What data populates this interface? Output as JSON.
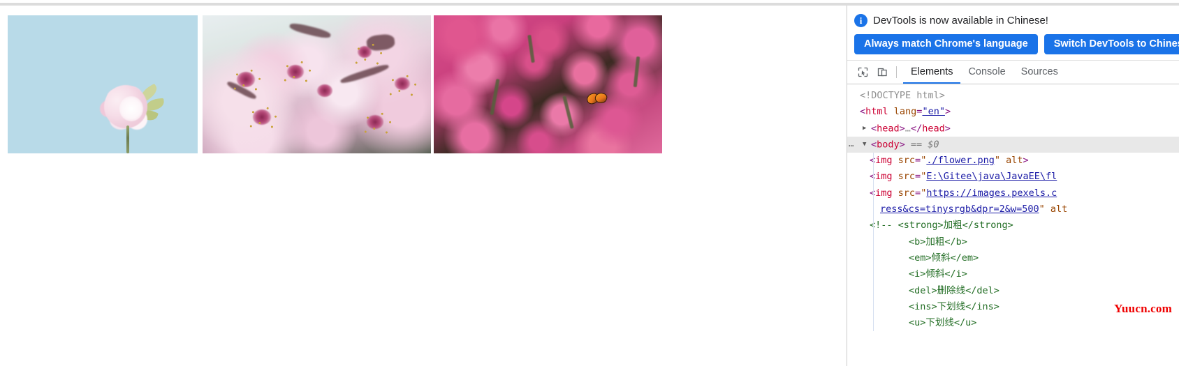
{
  "window": {
    "page_background": "#ffffff",
    "chrome_strip_color": "#dcdcdc"
  },
  "viewport": {
    "images": [
      {
        "name": "local-relative-flower",
        "alt": "",
        "description": "Pink cherry blossom on pale blue background",
        "dominant_color": "#b8dae8"
      },
      {
        "name": "absolute-path-flower",
        "alt": "",
        "description": "Close-up macro of pink cherry blossoms on branch",
        "dominant_color": "#e7cfdc"
      },
      {
        "name": "remote-pexels-flower",
        "alt": "",
        "description": "Dense cluster of pink phlox flowers with an orange butterfly",
        "dominant_color": "#d84f8b"
      }
    ]
  },
  "devtools": {
    "notice": {
      "icon": "info-icon",
      "icon_glyph": "i",
      "text": "DevTools is now available in Chinese!",
      "buttons": [
        {
          "label": "Always match Chrome's language",
          "color": "#1a73e8"
        },
        {
          "label": "Switch DevTools to Chinese",
          "color": "#1a73e8"
        }
      ]
    },
    "toolbar": {
      "inspect_icon": "inspect-element-icon",
      "device_icon": "device-toolbar-icon"
    },
    "tabs": [
      {
        "label": "Elements",
        "active": true
      },
      {
        "label": "Console",
        "active": false
      },
      {
        "label": "Sources",
        "active": false
      }
    ],
    "accent_color": "#1a73e8",
    "dom_tree": [
      {
        "id": "doctype",
        "indent": 0,
        "twisty": "",
        "selected": false,
        "parts": [
          {
            "t": "doctype",
            "s": "<!DOCTYPE html>"
          }
        ]
      },
      {
        "id": "html",
        "indent": 0,
        "twisty": "",
        "selected": false,
        "parts": [
          {
            "t": "punct",
            "s": "<"
          },
          {
            "t": "tagp",
            "s": "html"
          },
          {
            "t": "attr",
            "s": " lang"
          },
          {
            "t": "punct",
            "s": "="
          },
          {
            "t": "val-plain",
            "s": "\"en\""
          },
          {
            "t": "punct",
            "s": ">"
          }
        ]
      },
      {
        "id": "head",
        "indent": 1,
        "twisty": "collapsed",
        "selected": false,
        "parts": [
          {
            "t": "punct",
            "s": "<"
          },
          {
            "t": "tagp",
            "s": "head"
          },
          {
            "t": "punct",
            "s": ">"
          },
          {
            "t": "doctype",
            "s": "…"
          },
          {
            "t": "punct",
            "s": "</"
          },
          {
            "t": "tagp",
            "s": "head"
          },
          {
            "t": "punct",
            "s": ">"
          }
        ]
      },
      {
        "id": "body",
        "indent": 1,
        "twisty": "expanded",
        "selected": true,
        "ellipsis": "⋯",
        "parts": [
          {
            "t": "punct",
            "s": "<"
          },
          {
            "t": "tagp",
            "s": "body"
          },
          {
            "t": "punct",
            "s": ">"
          },
          {
            "t": "eq",
            "s": "  == $0"
          }
        ]
      },
      {
        "id": "img-1",
        "indent": 2,
        "twisty": "",
        "selected": false,
        "parts": [
          {
            "t": "punct",
            "s": "<"
          },
          {
            "t": "tagp",
            "s": "img"
          },
          {
            "t": "attr",
            "s": " src"
          },
          {
            "t": "punct",
            "s": "="
          },
          {
            "t": "quote",
            "s": "\""
          },
          {
            "t": "val",
            "s": "./flower.png"
          },
          {
            "t": "quote",
            "s": "\""
          },
          {
            "t": "attr",
            "s": " alt"
          },
          {
            "t": "punct",
            "s": ">"
          }
        ]
      },
      {
        "id": "img-2",
        "indent": 2,
        "twisty": "",
        "selected": false,
        "parts": [
          {
            "t": "punct",
            "s": "<"
          },
          {
            "t": "tagp",
            "s": "img"
          },
          {
            "t": "attr",
            "s": " src"
          },
          {
            "t": "punct",
            "s": "="
          },
          {
            "t": "quote",
            "s": "\""
          },
          {
            "t": "val",
            "s": "E:\\Gitee\\java\\JavaEE\\fl"
          },
          {
            "t": "quote",
            "s": ""
          }
        ]
      },
      {
        "id": "img-3",
        "indent": 2,
        "twisty": "",
        "selected": false,
        "parts": [
          {
            "t": "punct",
            "s": "<"
          },
          {
            "t": "tagp",
            "s": "img"
          },
          {
            "t": "attr",
            "s": " src"
          },
          {
            "t": "punct",
            "s": "="
          },
          {
            "t": "quote",
            "s": "\""
          },
          {
            "t": "val",
            "s": "https://images.pexels.c"
          }
        ]
      },
      {
        "id": "img-3-wrap",
        "indent": 5,
        "twisty": "",
        "selected": false,
        "parts": [
          {
            "t": "val",
            "s": "ress&cs=tinysrgb&dpr=2&w=500"
          },
          {
            "t": "quote",
            "s": "\""
          },
          {
            "t": "attr",
            "s": " alt"
          }
        ]
      },
      {
        "id": "comment-1",
        "indent": 2,
        "twisty": "",
        "selected": false,
        "parts": [
          {
            "t": "comment",
            "s": "<!-- <strong>加粗</strong>"
          }
        ]
      },
      {
        "id": "comment-2",
        "indent": 4,
        "twisty": "",
        "selected": false,
        "parts": [
          {
            "t": "comment",
            "s": "<b>加粗</b>"
          }
        ]
      },
      {
        "id": "comment-3",
        "indent": 4,
        "twisty": "",
        "selected": false,
        "parts": [
          {
            "t": "comment",
            "s": "<em>倾斜</em>"
          }
        ]
      },
      {
        "id": "comment-4",
        "indent": 4,
        "twisty": "",
        "selected": false,
        "parts": [
          {
            "t": "comment",
            "s": "<i>倾斜</i>"
          }
        ]
      },
      {
        "id": "comment-5",
        "indent": 4,
        "twisty": "",
        "selected": false,
        "parts": [
          {
            "t": "comment",
            "s": "<del>删除线</del>"
          }
        ]
      },
      {
        "id": "comment-6",
        "indent": 4,
        "twisty": "",
        "selected": false,
        "parts": [
          {
            "t": "comment",
            "s": "<ins>下划线</ins>"
          }
        ]
      },
      {
        "id": "comment-7",
        "indent": 4,
        "twisty": "",
        "selected": false,
        "parts": [
          {
            "t": "comment",
            "s": "<u>下划线</u>"
          }
        ]
      }
    ],
    "watermark": "Yuucn.com"
  }
}
